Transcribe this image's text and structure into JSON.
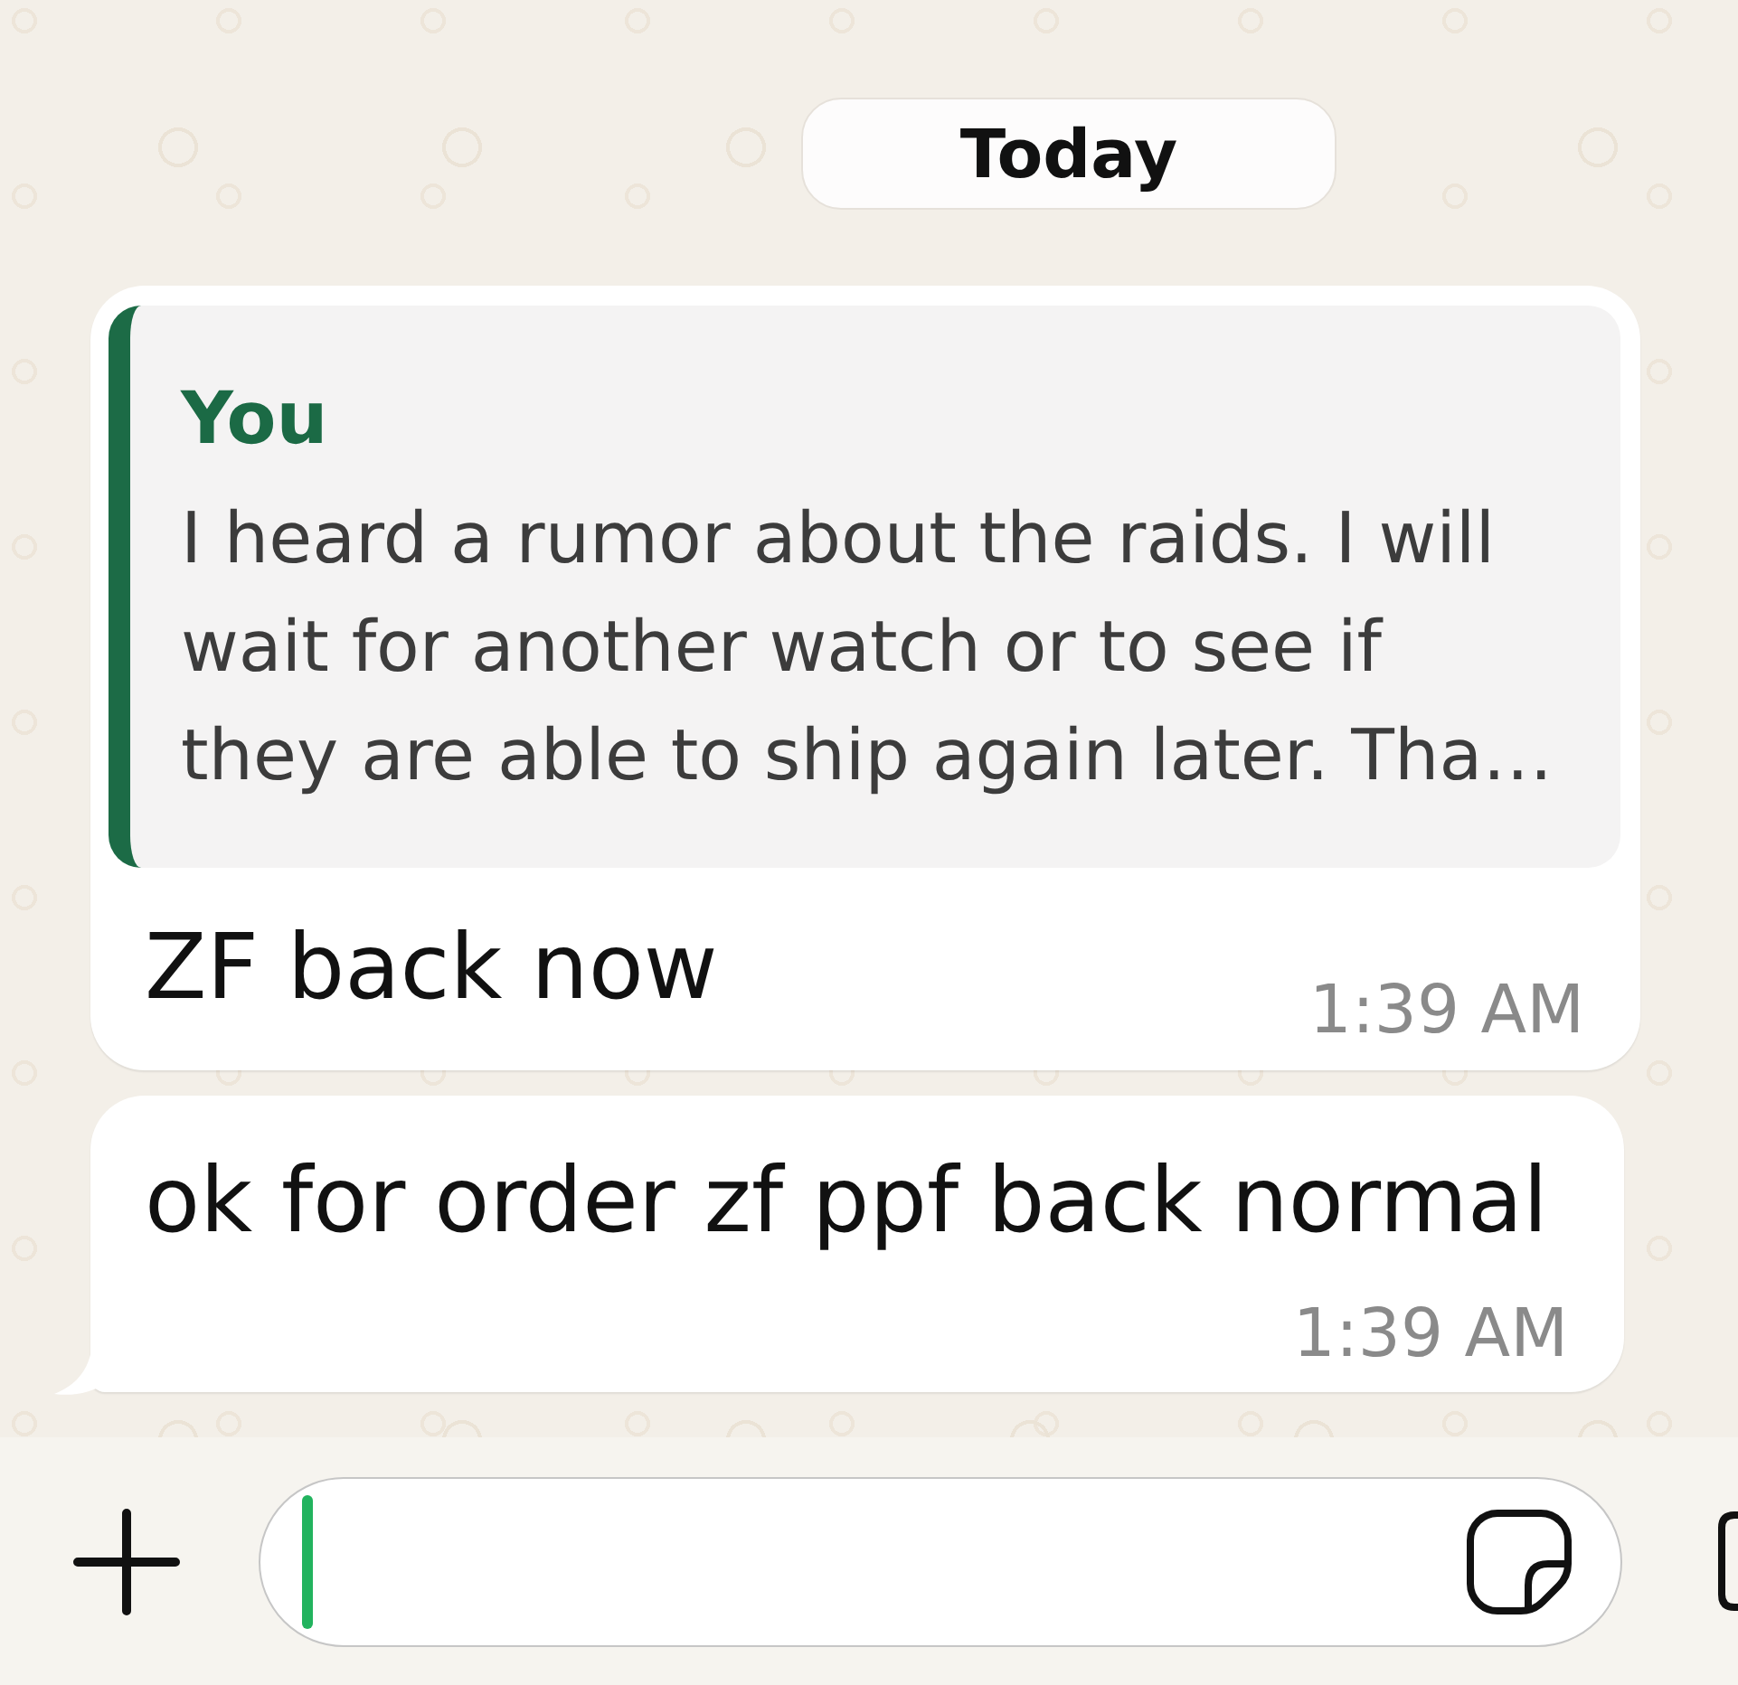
{
  "date_separator": {
    "label": "Today"
  },
  "messages": [
    {
      "quote": {
        "author": "You",
        "text": "I heard a rumor about the raids. I will\nwait for another watch or to see if\nthey are able to ship again later. Tha…"
      },
      "text": "ZF back now",
      "time": "1:39 AM",
      "tail": false
    },
    {
      "text": "ok for order zf ppf back normal",
      "time": "1:39 AM",
      "tail": true
    }
  ],
  "composer": {
    "input": {
      "focused": true
    }
  }
}
